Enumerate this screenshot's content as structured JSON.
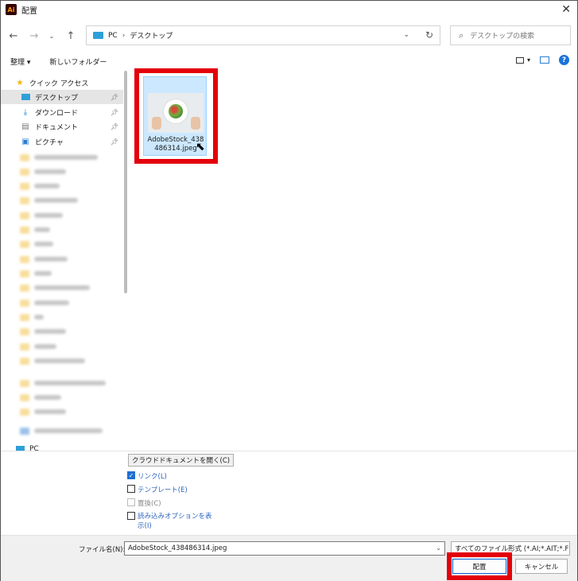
{
  "window": {
    "title": "配置",
    "app_icon": "Ai"
  },
  "address_bar": {
    "root": "PC",
    "current": "デスクトップ"
  },
  "search": {
    "placeholder": "デスクトップの検索"
  },
  "toolbar": {
    "organize": "整理",
    "new_folder": "新しいフォルダー"
  },
  "sidebar": {
    "quick_access": "クイック アクセス",
    "items": [
      {
        "label": "デスクトップ",
        "icon": "desktop-icon",
        "selected": true
      },
      {
        "label": "ダウンロード",
        "icon": "download-icon"
      },
      {
        "label": "ドキュメント",
        "icon": "document-icon"
      },
      {
        "label": "ピクチャ",
        "icon": "picture-icon"
      }
    ],
    "pc_label": "PC"
  },
  "file": {
    "name": "AdobeStock_438486314.jpeg",
    "display_name": "AdobeStock_438\n486314.jpeg"
  },
  "options": {
    "open_cloud_button": "クラウドドキュメントを開く(C)",
    "link": "リンク(L)",
    "template": "テンプレート(E)",
    "replace": "置換(C)",
    "show_import_options": "読み込みオプションを表示(I)"
  },
  "footer": {
    "filename_label": "ファイル名(N):",
    "filename_value": "AdobeStock_438486314.jpeg",
    "file_type": "すべてのファイル形式 (*.AI;*.AIT;*.F",
    "place_button": "配置",
    "cancel_button": "キャンセル"
  }
}
